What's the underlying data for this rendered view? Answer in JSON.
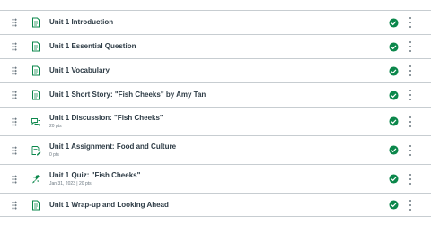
{
  "colors": {
    "published": "#0b874b",
    "page_icon": "#0b874b",
    "text": "#2d3b45",
    "meta": "#6b7780"
  },
  "items": [
    {
      "title": "Unit 1 Introduction",
      "meta": "",
      "icon": "page-icon"
    },
    {
      "title": "Unit 1 Essential Question",
      "meta": "",
      "icon": "page-icon"
    },
    {
      "title": "Unit 1 Vocabulary",
      "meta": "",
      "icon": "page-icon"
    },
    {
      "title": "Unit 1 Short Story: \"Fish Cheeks\" by Amy Tan",
      "meta": "",
      "icon": "page-icon"
    },
    {
      "title": "Unit 1 Discussion: \"Fish Cheeks\"",
      "meta": "20 pts",
      "icon": "discussion-icon"
    },
    {
      "title": "Unit 1 Assignment: Food and Culture",
      "meta": "0 pts",
      "icon": "assignment-icon"
    },
    {
      "title": "Unit 1 Quiz: \"Fish Cheeks\"",
      "meta": "Jan 31, 2023 | 20 pts",
      "icon": "quiz-icon"
    },
    {
      "title": "Unit 1 Wrap-up and Looking Ahead",
      "meta": "",
      "icon": "page-icon"
    }
  ]
}
